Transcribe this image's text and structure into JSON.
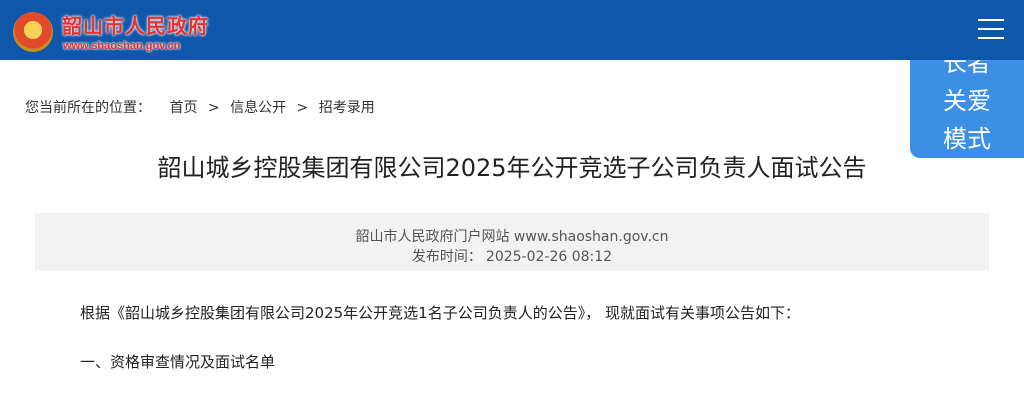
{
  "header": {
    "site_name": "韶山市人民政府",
    "site_url": "www.shaoshan.gov.cn",
    "menu_icon": "hamburger-menu-icon",
    "emblem_icon": "national-emblem-icon"
  },
  "care_mode": {
    "line1": "长者",
    "line2": "关爱",
    "line3": "模式"
  },
  "breadcrumb": {
    "label": "您当前所在的位置：",
    "items": [
      "首页",
      "信息公开",
      "招考录用"
    ],
    "separator": ">"
  },
  "article": {
    "title": "韶山城乡控股集团有限公司2025年公开竞选子公司负责人面试公告",
    "source": "韶山市人民政府门户网站 www.shaoshan.gov.cn",
    "date_label": "发布时间：",
    "date": "2025-02-26 08:12",
    "paragraphs": [
      "根据《韶山城乡控股集团有限公司2025年公开竞选1名子公司负责人的公告》，  现就面试有关事项公告如下：",
      "一、资格审查情况及面试名单"
    ]
  },
  "colors": {
    "header_bg": "#0f57aa",
    "brand_red": "#e8302f",
    "care_badge_bg": "#3d8fe6",
    "meta_bg": "#f2f2f2"
  }
}
